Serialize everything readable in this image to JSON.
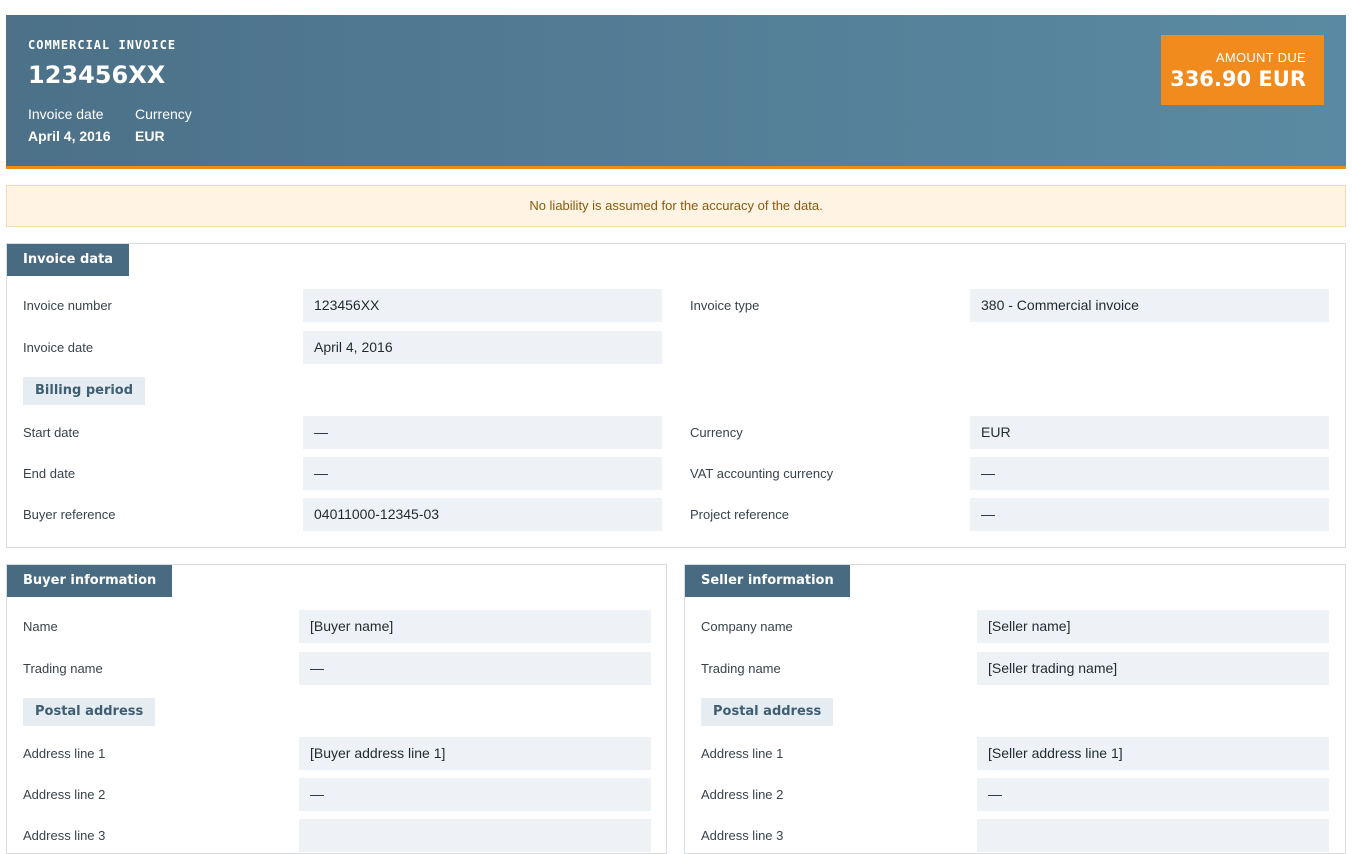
{
  "header": {
    "kicker": "COMMERCIAL INVOICE",
    "invoice_number": "123456XX",
    "invoice_date_label": "Invoice date",
    "invoice_date": "April 4, 2016",
    "currency_label": "Currency",
    "currency": "EUR",
    "amount_due_label": "AMOUNT DUE",
    "amount_due": "336.90 EUR"
  },
  "notice": "No liability is assumed for the accuracy of the data.",
  "invoice_data": {
    "title": "Invoice data",
    "invoice_number_label": "Invoice number",
    "invoice_number": "123456XX",
    "invoice_type_label": "Invoice type",
    "invoice_type": "380 - Commercial invoice",
    "invoice_date_label": "Invoice date",
    "invoice_date": "April 4, 2016",
    "billing_period": "Billing period",
    "start_date_label": "Start date",
    "start_date": "—",
    "currency_label": "Currency",
    "currency": "EUR",
    "end_date_label": "End date",
    "end_date": "—",
    "vat_currency_label": "VAT accounting currency",
    "vat_currency": "—",
    "buyer_reference_label": "Buyer reference",
    "buyer_reference": "04011000-12345-03",
    "project_reference_label": "Project reference",
    "project_reference": "—"
  },
  "buyer": {
    "title": "Buyer information",
    "name_label": "Name",
    "name": "[Buyer name]",
    "trading_name_label": "Trading name",
    "trading_name": "—",
    "postal_address": "Postal address",
    "address1_label": "Address line 1",
    "address1": "[Buyer address line 1]",
    "address2_label": "Address line 2",
    "address2": "—",
    "address3_label": "Address line 3"
  },
  "seller": {
    "title": "Seller information",
    "company_name_label": "Company name",
    "company_name": "[Seller name]",
    "trading_name_label": "Trading name",
    "trading_name": "[Seller trading name]",
    "postal_address": "Postal address",
    "address1_label": "Address line 1",
    "address1": "[Seller address line 1]",
    "address2_label": "Address line 2",
    "address2": "—",
    "address3_label": "Address line 3"
  }
}
